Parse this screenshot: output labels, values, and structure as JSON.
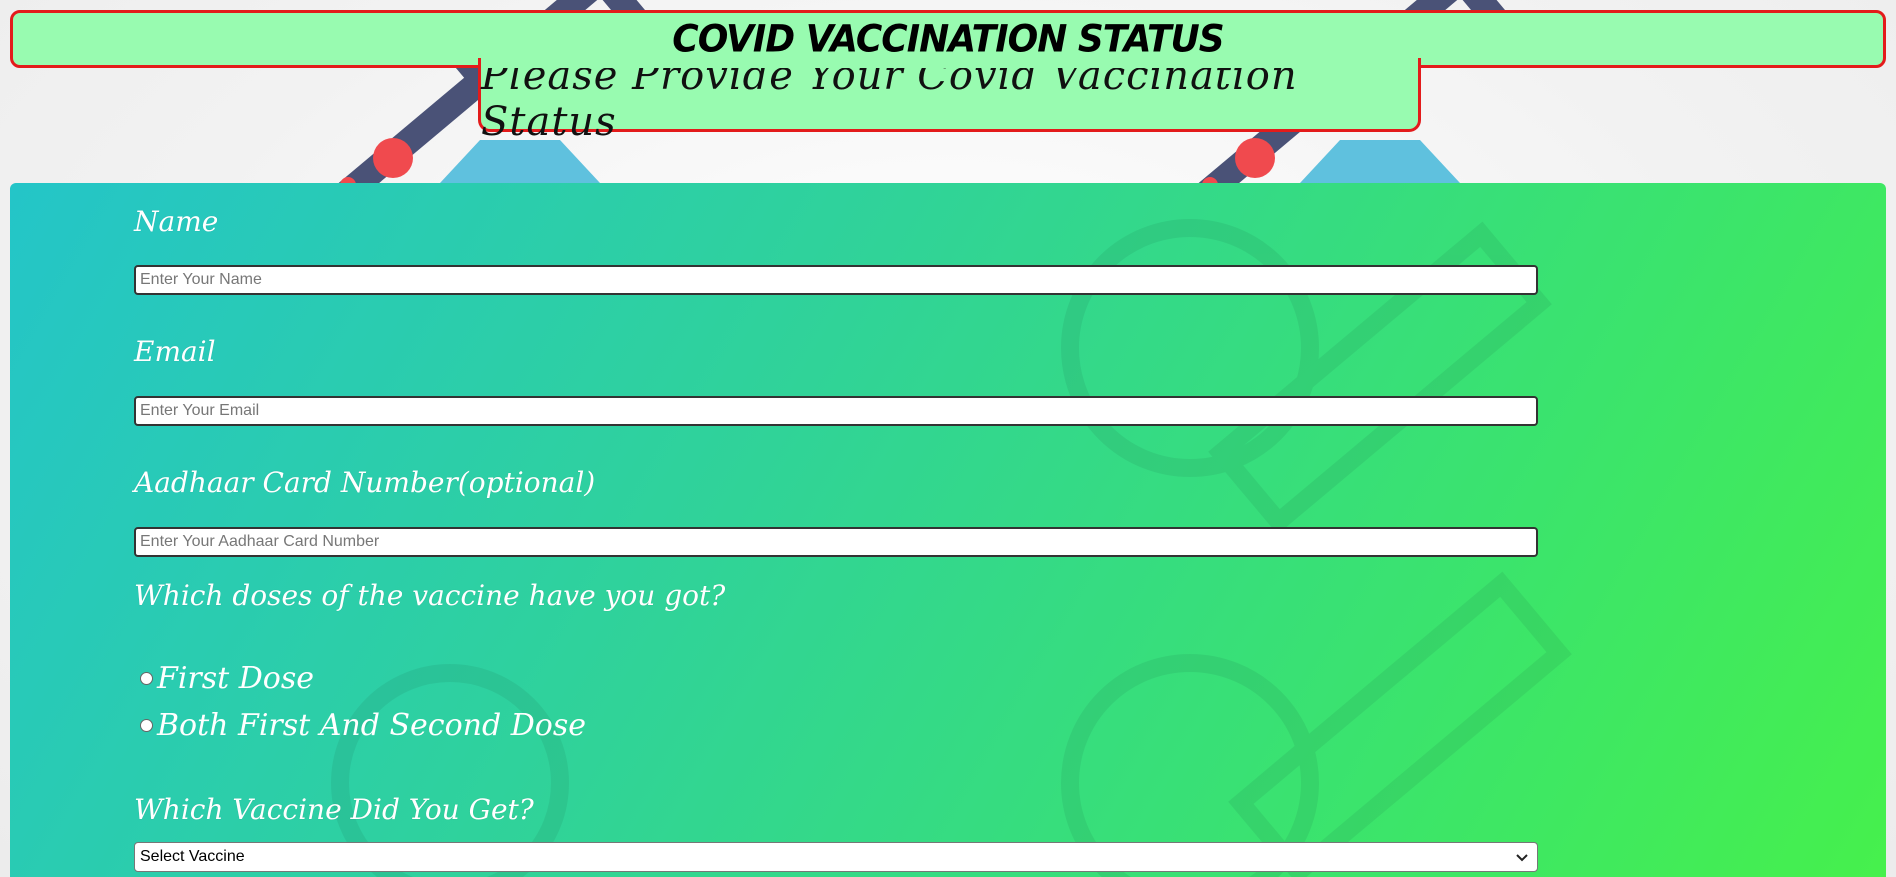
{
  "header": {
    "title": "COVID VACCINATION STATUS",
    "subtitle": "Please Provide Your Covid Vaccination Status"
  },
  "colors": {
    "banner_bg": "#98fbb0",
    "banner_border": "#e31b1b",
    "panel_gradient_start": "#24c5c8",
    "panel_gradient_end": "#46f04c"
  },
  "form": {
    "name": {
      "label": "Name",
      "placeholder": "Enter Your Name",
      "value": ""
    },
    "email": {
      "label": "Email",
      "placeholder": "Enter Your Email",
      "value": ""
    },
    "aadhaar": {
      "label": "Aadhaar Card Number(optional)",
      "placeholder": "Enter Your Aadhaar Card Number",
      "value": ""
    },
    "doses": {
      "question": "Which doses of the vaccine have you got?",
      "options": [
        {
          "label": "First Dose",
          "checked": false
        },
        {
          "label": "Both First And Second Dose",
          "checked": false
        }
      ]
    },
    "vaccine": {
      "question": "Which Vaccine Did You Get?",
      "selected": "Select Vaccine"
    }
  },
  "icons": [
    "syringe-icon",
    "virus-icon",
    "chevron-down-icon",
    "radio-icon"
  ]
}
